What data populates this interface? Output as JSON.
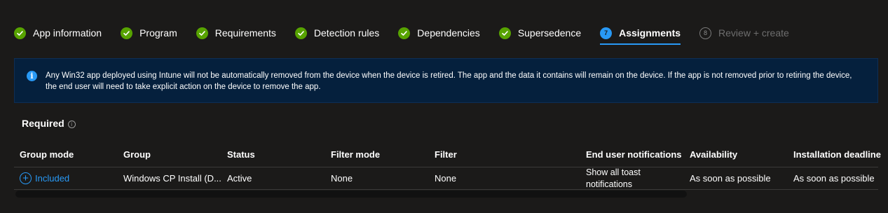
{
  "wizard": {
    "steps": [
      {
        "label": "App information",
        "state": "done"
      },
      {
        "label": "Program",
        "state": "done"
      },
      {
        "label": "Requirements",
        "state": "done"
      },
      {
        "label": "Detection rules",
        "state": "done"
      },
      {
        "label": "Dependencies",
        "state": "done"
      },
      {
        "label": "Supersedence",
        "state": "done"
      },
      {
        "label": "Assignments",
        "number": "7",
        "state": "current"
      },
      {
        "label": "Review + create",
        "number": "8",
        "state": "pending"
      }
    ]
  },
  "banner": {
    "icon": "info-icon",
    "message": "Any Win32 app deployed using Intune will not be automatically removed from the device when the device is retired. The app and the data it contains will remain on the device. If the app is not removed prior to retiring the device, the end user will need to take explicit action on the device to remove the app."
  },
  "section": {
    "title": "Required",
    "help_icon": "info-circle-icon"
  },
  "table": {
    "columns": [
      "Group mode",
      "Group",
      "Status",
      "Filter mode",
      "Filter",
      "End user notifications",
      "Availability",
      "Installation deadline"
    ],
    "rows": [
      {
        "group_mode": "Included",
        "group": "Windows CP Install (D...",
        "status": "Active",
        "filter_mode": "None",
        "filter": "None",
        "notifications": "Show all toast notifications",
        "availability": "As soon as possible",
        "deadline": "As soon as possible"
      }
    ]
  },
  "colors": {
    "background": "#1b1a19",
    "accent": "#2899f5",
    "done": "#57a300",
    "banner_bg": "#05203d"
  }
}
